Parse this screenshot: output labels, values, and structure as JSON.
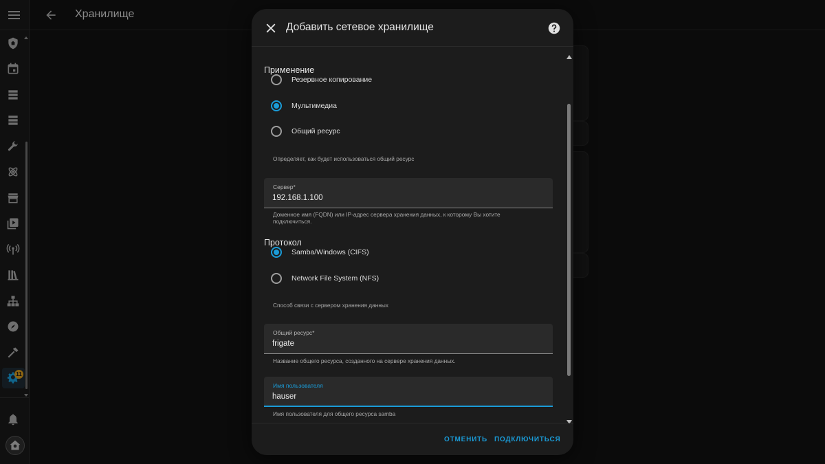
{
  "topbar": {
    "title": "Хранилище"
  },
  "sidebar": {
    "items": [
      {
        "icon": "shield-home-icon"
      },
      {
        "icon": "calendar-icon"
      },
      {
        "icon": "server-icon"
      },
      {
        "icon": "database-icon"
      },
      {
        "icon": "wrench-icon"
      },
      {
        "icon": "atom-icon"
      },
      {
        "icon": "store-icon"
      },
      {
        "icon": "play-box-icon"
      },
      {
        "icon": "antenna-icon"
      },
      {
        "icon": "library-icon"
      },
      {
        "icon": "sitemap-icon"
      },
      {
        "icon": "compass-icon"
      },
      {
        "icon": "hammer-icon"
      },
      {
        "icon": "cog-icon",
        "badge": "11"
      }
    ],
    "notifications_icon": "bell-icon"
  },
  "dialog": {
    "title": "Добавить сетевое хранилище",
    "usage": {
      "title": "Применение",
      "options": [
        "Резервное копирование",
        "Мультимедиа",
        "Общий ресурс"
      ],
      "selected": "Мультимедиа",
      "helper": "Определяет, как будет использоваться общий ресурс"
    },
    "server": {
      "label": "Сервер*",
      "value": "192.168.1.100",
      "helper_line1": "Доменное имя (FQDN) или IP-адрес сервера хранения данных, к которому Вы хотите",
      "helper_line2": "подключиться."
    },
    "protocol": {
      "title": "Протокол",
      "options": [
        "Samba/Windows (CIFS)",
        "Network File System (NFS)"
      ],
      "selected": "Samba/Windows (CIFS)",
      "helper": "Способ связи с сервером хранения данных"
    },
    "share": {
      "label": "Общий ресурс*",
      "value": "frigate",
      "helper": "Название общего ресурса, созданного на сервере хранения данных."
    },
    "username": {
      "label": "Имя пользователя",
      "value": "hauser",
      "helper": "Имя пользователя для общего ресурса samba"
    },
    "cancel_label": "ОТМЕНИТЬ",
    "connect_label": "ПОДКЛЮЧИТЬСЯ"
  },
  "colors": {
    "accent": "#1a9bd7",
    "badge": "#d79a1d",
    "dialog_bg": "#1c1c1c",
    "field_bg": "#2a2a2a"
  }
}
